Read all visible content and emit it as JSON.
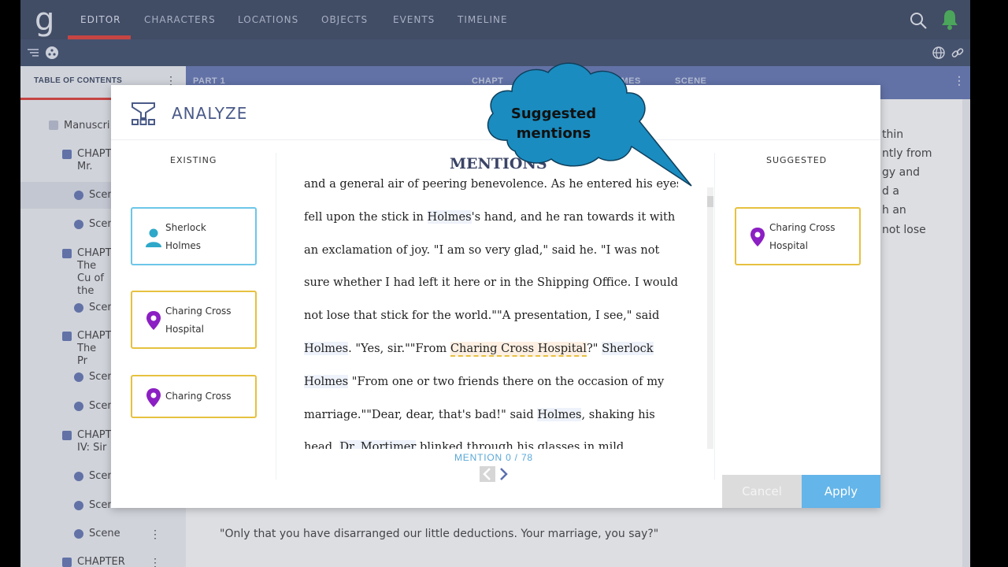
{
  "nav": {
    "items": [
      "EDITOR",
      "CHARACTERS",
      "LOCATIONS",
      "OBJECTS",
      "EVENTS",
      "TIMELINE"
    ],
    "active": "EDITOR",
    "accent": "#e0332b",
    "bell_color": "#3cb34a"
  },
  "sidebar": {
    "title": "TABLE OF CONTENTS",
    "items": [
      {
        "label": "Manuscri",
        "type": "root"
      },
      {
        "label": "CHAPT Mr.",
        "type": "chapter"
      },
      {
        "label": "Scen",
        "type": "scene"
      },
      {
        "label": "Scen",
        "type": "scene"
      },
      {
        "label": "CHAPT The Cu of the",
        "type": "chapter"
      },
      {
        "label": "Scen",
        "type": "scene"
      },
      {
        "label": "CHAPT The Pr",
        "type": "chapter"
      },
      {
        "label": "Scen",
        "type": "scene"
      },
      {
        "label": "Scen",
        "type": "scene"
      },
      {
        "label": "CHAPT IV: Sir",
        "type": "chapter"
      },
      {
        "label": "Scen",
        "type": "scene"
      },
      {
        "label": "Scen",
        "type": "scene"
      },
      {
        "label": "Scene",
        "type": "scene"
      },
      {
        "label": "CHAPTER",
        "type": "chapter"
      }
    ]
  },
  "breadcrumb": {
    "part": "PART 1",
    "chapter": "CHAPT",
    "chapter_title": "LOCK HOLMES",
    "scene": "SCENE"
  },
  "document": {
    "right_fragments": [
      "thin",
      "ntly from",
      "gy and",
      "d a",
      "h an",
      "not lose"
    ],
    "bottom_line_1": "\"Only that you have disarranged our little deductions. Your marriage, you say?\""
  },
  "modal": {
    "title": "ANALYZE",
    "existing_label": "EXISTING",
    "suggested_label": "SUGGESTED",
    "mentions_title": "MENTIONS",
    "existing_cards": [
      {
        "type": "character",
        "line1": "Sherlock",
        "line2": "Holmes"
      },
      {
        "type": "location",
        "line1": "Charing Cross",
        "line2": "Hospital"
      },
      {
        "type": "location",
        "line1": "Charing Cross",
        "line2": ""
      }
    ],
    "suggested_cards": [
      {
        "type": "location",
        "line1": "Charing Cross",
        "line2": "Hospital"
      }
    ],
    "text": {
      "l0": "and a general air of peering benevolence. As he entered his eyes",
      "l1a": "fell upon the stick in ",
      "l1b": "Holmes",
      "l1c": "'s hand, and he ran towards it with",
      "l2": "an exclamation of joy. \"I am so very glad,\" said he. \"I was not",
      "l3": "sure whether I had left it here or in the Shipping Office. I would",
      "l4": "not lose that stick for the world.\"\"A presentation, I see,\" said",
      "l5a": "Holmes",
      "l5b": ". \"Yes, sir.\"\"From ",
      "l5c": "Charing Cross Hospital",
      "l5d": "?\" ",
      "l5e": "Sherlock",
      "l6a": "Holmes",
      "l6b": " \"From one or two friends there on the occasion of my",
      "l7a": "marriage.\"\"Dear, dear, that's bad!\" said ",
      "l7b": "Holmes",
      "l7c": ", shaking his",
      "l8a": "head. ",
      "l8b": "Dr. Mortimer",
      "l8c": " blinked through his glasses in mild"
    },
    "mention_counter": "MENTION 0 / 78",
    "cancel_label": "Cancel",
    "apply_label": "Apply",
    "location_color": "#8b1fc3",
    "character_color": "#2ea8c9",
    "location_border": "#e6c13f",
    "character_border": "#6cc6e8"
  },
  "callout": {
    "line1": "Suggested",
    "line2": "mentions",
    "color": "#1a8cc0"
  }
}
